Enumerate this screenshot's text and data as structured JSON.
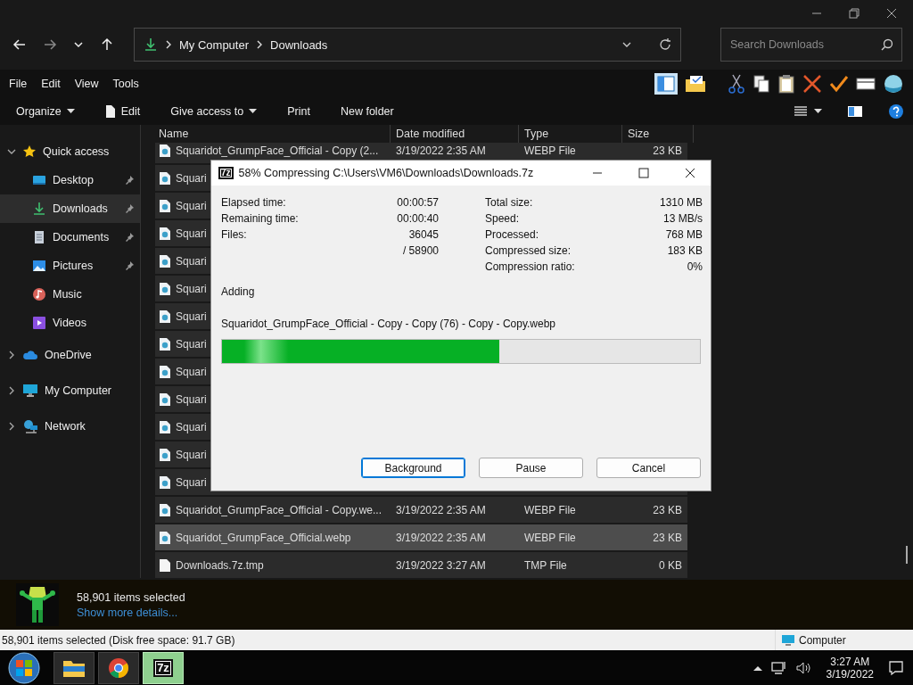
{
  "address": {
    "path": [
      "My Computer",
      "Downloads"
    ]
  },
  "search": {
    "placeholder": "Search Downloads"
  },
  "menu": [
    "File",
    "Edit",
    "View",
    "Tools"
  ],
  "commands": [
    {
      "label": "Organize",
      "kind": "dropdown"
    },
    {
      "label": "Edit",
      "kind": "icon"
    },
    {
      "label": "Give access to",
      "kind": "dropdown"
    },
    {
      "label": "Print",
      "kind": "plain"
    },
    {
      "label": "New folder",
      "kind": "plain"
    }
  ],
  "sidebar": {
    "items": [
      {
        "label": "Quick access",
        "kind": "star",
        "expanded": true,
        "children": [
          {
            "label": "Desktop",
            "kind": "desktop",
            "pinned": true,
            "selected": false
          },
          {
            "label": "Downloads",
            "kind": "download",
            "pinned": true,
            "selected": true
          },
          {
            "label": "Documents",
            "kind": "document",
            "pinned": true,
            "selected": false
          },
          {
            "label": "Pictures",
            "kind": "pictures",
            "pinned": true,
            "selected": false
          },
          {
            "label": "Music",
            "kind": "music",
            "pinned": false,
            "selected": false
          },
          {
            "label": "Videos",
            "kind": "videos",
            "pinned": false,
            "selected": false
          }
        ]
      },
      {
        "label": "OneDrive",
        "kind": "cloud",
        "expanded": false
      },
      {
        "label": "My Computer",
        "kind": "computer",
        "expanded": false
      },
      {
        "label": "Network",
        "kind": "network",
        "expanded": false
      }
    ]
  },
  "columns": [
    "Name",
    "Date modified",
    "Type",
    "Size"
  ],
  "rows": [
    {
      "name": "Squaridot_GrumpFace_Official - Copy (2...",
      "date": "3/19/2022 2:35 AM",
      "type": "WEBP File",
      "size": "23 KB",
      "kind": "webp",
      "hovered": false
    },
    {
      "name": "Squari",
      "kind": "webp",
      "hovered": false
    },
    {
      "name": "Squari",
      "kind": "webp",
      "hovered": false
    },
    {
      "name": "Squari",
      "kind": "webp",
      "hovered": false
    },
    {
      "name": "Squari",
      "kind": "webp",
      "hovered": false
    },
    {
      "name": "Squari",
      "kind": "webp",
      "hovered": false
    },
    {
      "name": "Squari",
      "kind": "webp",
      "hovered": false
    },
    {
      "name": "Squari",
      "kind": "webp",
      "hovered": false
    },
    {
      "name": "Squari",
      "kind": "webp",
      "hovered": false
    },
    {
      "name": "Squari",
      "kind": "webp",
      "hovered": false
    },
    {
      "name": "Squari",
      "kind": "webp",
      "hovered": false
    },
    {
      "name": "Squari",
      "kind": "webp",
      "hovered": false
    },
    {
      "name": "Squari",
      "kind": "webp",
      "hovered": false
    },
    {
      "name": "Squaridot_GrumpFace_Official - Copy.we...",
      "date": "3/19/2022 2:35 AM",
      "type": "WEBP File",
      "size": "23 KB",
      "kind": "webp",
      "hovered": false
    },
    {
      "name": "Squaridot_GrumpFace_Official.webp",
      "date": "3/19/2022 2:35 AM",
      "type": "WEBP File",
      "size": "23 KB",
      "kind": "webp",
      "hovered": true
    },
    {
      "name": "Downloads.7z.tmp",
      "date": "3/19/2022 3:27 AM",
      "type": "TMP File",
      "size": "0 KB",
      "kind": "blank",
      "hovered": false
    }
  ],
  "dialog": {
    "icon_text": "7z",
    "title": "58% Compressing C:\\Users\\VM6\\Downloads\\Downloads.7z",
    "left_stats": [
      {
        "label": "Elapsed time:",
        "value": "00:00:57"
      },
      {
        "label": "Remaining time:",
        "value": "00:00:40"
      },
      {
        "label": "Files:",
        "value": "36045"
      },
      {
        "value": "/ 58900"
      }
    ],
    "right_stats": [
      {
        "label": "Total size:",
        "value": "1310 MB"
      },
      {
        "label": "Speed:",
        "value": "13 MB/s"
      },
      {
        "label": "Processed:",
        "value": "768 MB"
      },
      {
        "label": "Compressed size:",
        "value": "183 KB"
      },
      {
        "label": "Compression ratio:",
        "value": "0%"
      }
    ],
    "status": "Adding",
    "current_file": "Squaridot_GrumpFace_Official - Copy - Copy (76) - Copy - Copy.webp",
    "progress": {
      "level": 0.58
    },
    "buttons": [
      {
        "label": "Background",
        "default": true
      },
      {
        "label": "Pause",
        "default": false
      },
      {
        "label": "Cancel",
        "default": false
      }
    ]
  },
  "details": {
    "count": "58,901 items selected",
    "link": "Show more details..."
  },
  "status_bar": {
    "text": "58,901 items selected (Disk free space: 91.7 GB)",
    "location": "Computer"
  },
  "taskbar": {
    "apps": [
      {
        "kind": "explorer",
        "active": false
      },
      {
        "kind": "chrome",
        "active": false
      },
      {
        "kind": "archiver",
        "label": "7z",
        "active": true
      }
    ],
    "time": "3:27 AM",
    "date": "3/19/2022"
  }
}
